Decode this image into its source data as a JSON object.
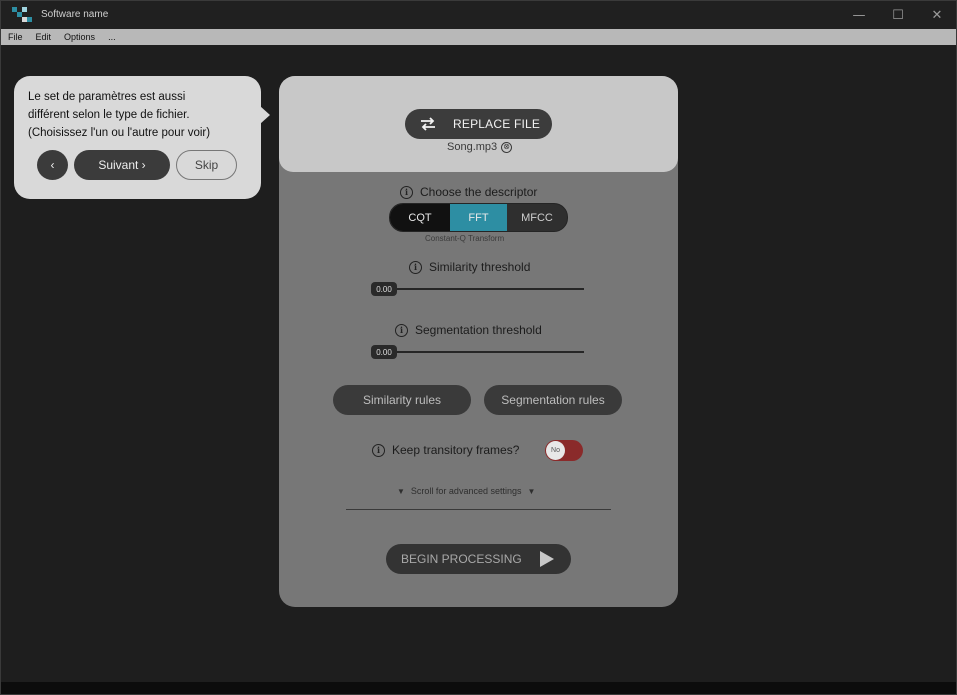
{
  "window": {
    "title": "Software name",
    "controls": {
      "minimize": "—",
      "maximize": "☐",
      "close": "✕"
    }
  },
  "menu": [
    "File",
    "Edit",
    "Options",
    "..."
  ],
  "tooltip": {
    "lines": [
      "Le set de paramètres est aussi",
      "différent selon le type de fichier.",
      "(Choisissez l'un ou l'autre pour voir)"
    ],
    "prev_label": "‹",
    "next_label": "Suivant ›",
    "skip_label": "Skip"
  },
  "file": {
    "replace_label": "REPLACE FILE",
    "filename": "Song.mp3",
    "remove_icon": "⊗"
  },
  "descriptor": {
    "label": "Choose the descriptor",
    "options": [
      "CQT",
      "FFT",
      "MFCC"
    ],
    "selected": "FFT",
    "caption": "Constant-Q Transform"
  },
  "similarity": {
    "label": "Similarity threshold",
    "value": "0.00"
  },
  "segmentation": {
    "label": "Segmentation threshold",
    "value": "0.00"
  },
  "rules": {
    "similarity_label": "Similarity rules",
    "segmentation_label": "Segmentation rules"
  },
  "transitory": {
    "label": "Keep transitory frames?",
    "toggle_text": "No",
    "on": false
  },
  "advanced": {
    "label": "Scroll for advanced settings"
  },
  "begin": {
    "label": "BEGIN PROCESSING"
  },
  "colors": {
    "accent": "#2d8ea3",
    "toggle_off": "#8a2a2a"
  }
}
